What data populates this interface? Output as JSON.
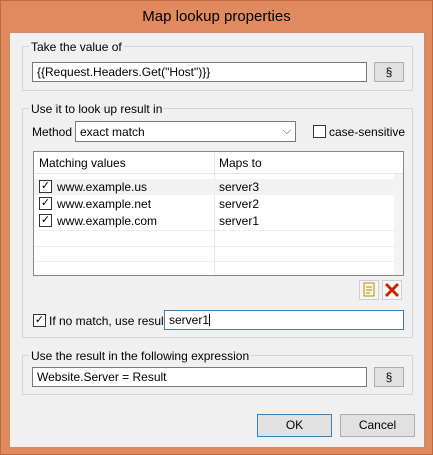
{
  "window": {
    "title": "Map lookup properties"
  },
  "take_value": {
    "group_title": "Take the value of",
    "input_value": "{{Request.Headers.Get(\"Host\")}}",
    "section_button": "§"
  },
  "lookup": {
    "group_title": "Use it to look up result in",
    "method_label": "Method",
    "method_value": "exact match",
    "case_sensitive_label": "case-sensitive",
    "case_sensitive_checked": false,
    "columns": [
      "Matching values",
      "Maps to"
    ],
    "rows": [
      {
        "checked": true,
        "match": "www.example.us",
        "maps_to": "server3"
      },
      {
        "checked": true,
        "match": "www.example.net",
        "maps_to": "server2"
      },
      {
        "checked": true,
        "match": "www.example.com",
        "maps_to": "server1"
      }
    ],
    "no_match_label": "If no match, use result:",
    "no_match_checked": true,
    "no_match_value": "server1"
  },
  "expression": {
    "group_title": "Use the result in the following expression",
    "input_value": "Website.Server = Result",
    "section_button": "§"
  },
  "buttons": {
    "ok": "OK",
    "cancel": "Cancel"
  },
  "colors": {
    "titlebar": "#e08a5f",
    "client": "#f0f0f0",
    "delete_icon": "#cc2200"
  }
}
